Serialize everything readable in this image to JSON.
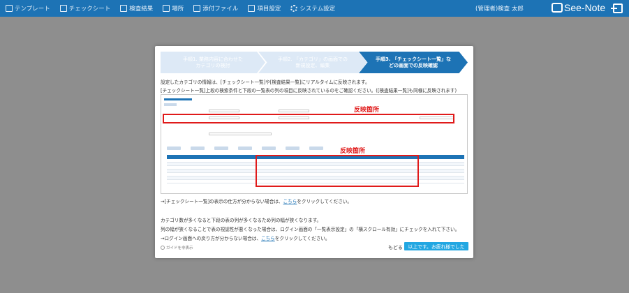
{
  "nav": {
    "items": [
      {
        "label": "テンプレート",
        "icon": "document-icon"
      },
      {
        "label": "チェックシート",
        "icon": "checksheet-icon"
      },
      {
        "label": "検査結果",
        "icon": "result-icon"
      },
      {
        "label": "場所",
        "icon": "building-icon"
      },
      {
        "label": "添付ファイル",
        "icon": "attachment-icon"
      },
      {
        "label": "項目設定",
        "icon": "settings-doc-icon"
      },
      {
        "label": "システム設定",
        "icon": "gear-icon"
      }
    ],
    "user": "(管理者)検査 太郎",
    "brand": "See-Note"
  },
  "modal": {
    "steps": [
      "手順1. 業務内容に合わせた\nカテゴリの検討",
      "手順2. 「カテゴリ」の画面での\n新規設定、編集",
      "手順3. 「チェックシート一覧」な\nどの画面での反映確認"
    ],
    "line1": "設定したカテゴリの情報は、[チェックシート一覧]や[検査結果一覧]にリアルタイムに反映されます。",
    "line2": "[チェックシート一覧]上段の検索条件と下段の一覧表の列の項目に反映されているのをご確認ください。([検査結果一覧]も同様に反映されます)",
    "annotation1": "反映箇所",
    "annotation2": "反映箇所",
    "line3_prefix": "→[チェックシート一覧]の表示の仕方が分からない場合は、",
    "line3_link": "こちら",
    "line3_suffix": "をクリックしてください。",
    "line4": "カテゴリ数が多くなると下段の表の列が多くなるため列の幅が狭くなります。",
    "line5": "列の幅が狭くなることで表の視認性が悪くなった場合は、ログイン画面の「一覧表示設定」の「横スクロール有効」にチェックを入れて下さい。",
    "line6_prefix": "→ログイン画面への戻り方が分からない場合は、",
    "line6_link": "こちら",
    "line6_suffix": "をクリックしてください。",
    "hide_guide": "ガイドを非表示",
    "back": "もどる",
    "done": "以上です。お疲れ様でした"
  },
  "colors": {
    "nav_bg": "#1d73b5",
    "accent": "#22a7e2",
    "highlight": "#e01a1a"
  }
}
